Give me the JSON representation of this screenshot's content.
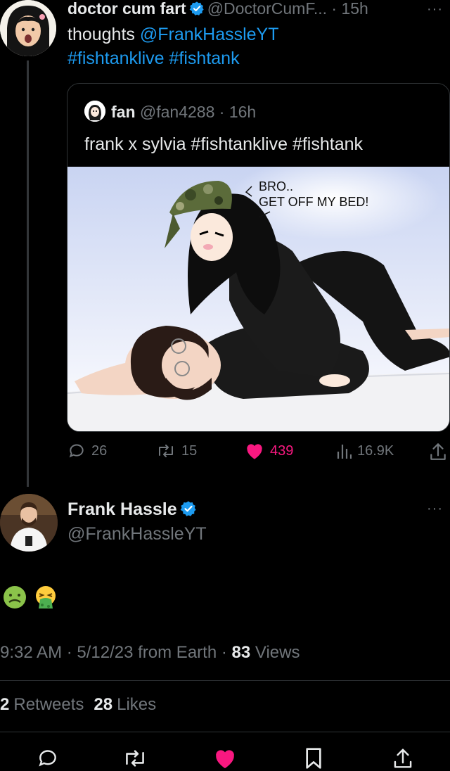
{
  "tweet1": {
    "name": "doctor cum fart",
    "handle": "@DoctorCumF...",
    "separator": "·",
    "time": "15h",
    "more": "···",
    "text_prefix": "thoughts ",
    "mention": "@FrankHassleYT",
    "hashtags": "#fishtanklive #fishtank",
    "actions": {
      "replies": "26",
      "retweets": "15",
      "likes": "439",
      "views": "16.9K"
    }
  },
  "quote": {
    "name": "fan",
    "handle": "@fan4288",
    "separator": "·",
    "time": "16h",
    "text": "frank x sylvia #fishtanklive #fishtank",
    "image": {
      "bubble_line1": "BRO..",
      "bubble_line2": "GET OFF MY BED!"
    }
  },
  "tweet2": {
    "name": "Frank Hassle",
    "handle": "@FrankHassleYT",
    "more": "···",
    "emojis": [
      "nauseated-face",
      "vomiting-face"
    ],
    "meta": {
      "time": "9:32 AM",
      "sep1": " · ",
      "date": "5/12/23",
      "from": " from Earth",
      "sep2": " · ",
      "views_count": "83",
      "views_label": " Views"
    },
    "stats": {
      "retweets_count": "2",
      "retweets_label": "Retweets",
      "likes_count": "28",
      "likes_label": "Likes"
    }
  },
  "colors": {
    "accent": "#1d9bf0",
    "like": "#f91880",
    "muted": "#71767b",
    "border": "#2f3336"
  }
}
